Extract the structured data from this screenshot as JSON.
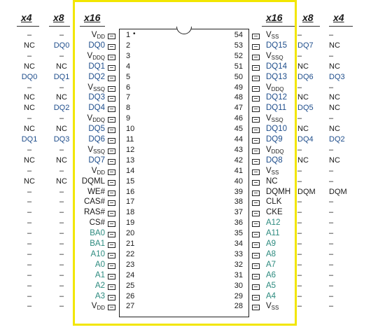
{
  "headers": {
    "left_x4": "x4",
    "left_x8": "x8",
    "left_x16": "x16",
    "right_x16": "x16",
    "right_x8": "x8",
    "right_x4": "x4"
  },
  "pins_left": [
    {
      "num": "1",
      "sig": "V",
      "sub": "DD",
      "x8": "–",
      "x4": "–",
      "c": "dark"
    },
    {
      "num": "2",
      "sig": "DQ0",
      "sub": "",
      "x8": "DQ0",
      "x4": "NC",
      "c": "blue"
    },
    {
      "num": "3",
      "sig": "V",
      "sub": "DDQ",
      "x8": "–",
      "x4": "–",
      "c": "dark"
    },
    {
      "num": "4",
      "sig": "DQ1",
      "sub": "",
      "x8": "NC",
      "x4": "NC",
      "c": "blue"
    },
    {
      "num": "5",
      "sig": "DQ2",
      "sub": "",
      "x8": "DQ1",
      "x4": "DQ0",
      "c": "blue"
    },
    {
      "num": "6",
      "sig": "V",
      "sub": "SSQ",
      "x8": "–",
      "x4": "–",
      "c": "dark"
    },
    {
      "num": "7",
      "sig": "DQ3",
      "sub": "",
      "x8": "NC",
      "x4": "NC",
      "c": "blue"
    },
    {
      "num": "8",
      "sig": "DQ4",
      "sub": "",
      "x8": "DQ2",
      "x4": "NC",
      "c": "blue"
    },
    {
      "num": "9",
      "sig": "V",
      "sub": "DDQ",
      "x8": "–",
      "x4": "–",
      "c": "dark"
    },
    {
      "num": "10",
      "sig": "DQ5",
      "sub": "",
      "x8": "NC",
      "x4": "NC",
      "c": "blue"
    },
    {
      "num": "11",
      "sig": "DQ6",
      "sub": "",
      "x8": "DQ3",
      "x4": "DQ1",
      "c": "blue"
    },
    {
      "num": "12",
      "sig": "V",
      "sub": "SSQ",
      "x8": "–",
      "x4": "–",
      "c": "dark"
    },
    {
      "num": "13",
      "sig": "DQ7",
      "sub": "",
      "x8": "NC",
      "x4": "NC",
      "c": "blue"
    },
    {
      "num": "14",
      "sig": "V",
      "sub": "DD",
      "x8": "–",
      "x4": "–",
      "c": "dark"
    },
    {
      "num": "15",
      "sig": "DQML",
      "sub": "",
      "x8": "NC",
      "x4": "NC",
      "c": "dark"
    },
    {
      "num": "16",
      "sig": "WE#",
      "sub": "",
      "x8": "–",
      "x4": "–",
      "c": "dark"
    },
    {
      "num": "17",
      "sig": "CAS#",
      "sub": "",
      "x8": "–",
      "x4": "–",
      "c": "dark"
    },
    {
      "num": "18",
      "sig": "RAS#",
      "sub": "",
      "x8": "–",
      "x4": "–",
      "c": "dark"
    },
    {
      "num": "19",
      "sig": "CS#",
      "sub": "",
      "x8": "–",
      "x4": "–",
      "c": "dark"
    },
    {
      "num": "20",
      "sig": "BA0",
      "sub": "",
      "x8": "–",
      "x4": "–",
      "c": "teal"
    },
    {
      "num": "21",
      "sig": "BA1",
      "sub": "",
      "x8": "–",
      "x4": "–",
      "c": "teal"
    },
    {
      "num": "22",
      "sig": "A10",
      "sub": "",
      "x8": "–",
      "x4": "–",
      "c": "teal"
    },
    {
      "num": "23",
      "sig": "A0",
      "sub": "",
      "x8": "–",
      "x4": "–",
      "c": "teal"
    },
    {
      "num": "24",
      "sig": "A1",
      "sub": "",
      "x8": "–",
      "x4": "–",
      "c": "teal"
    },
    {
      "num": "25",
      "sig": "A2",
      "sub": "",
      "x8": "–",
      "x4": "–",
      "c": "teal"
    },
    {
      "num": "26",
      "sig": "A3",
      "sub": "",
      "x8": "–",
      "x4": "–",
      "c": "teal"
    },
    {
      "num": "27",
      "sig": "V",
      "sub": "DD",
      "x8": "–",
      "x4": "–",
      "c": "dark"
    }
  ],
  "pins_right": [
    {
      "num": "54",
      "sig": "V",
      "sub": "SS",
      "x8": "–",
      "x4": "–",
      "c": "dark"
    },
    {
      "num": "53",
      "sig": "DQ15",
      "sub": "",
      "x8": "DQ7",
      "x4": "NC",
      "c": "blue"
    },
    {
      "num": "52",
      "sig": "V",
      "sub": "SSQ",
      "x8": "–",
      "x4": "–",
      "c": "dark"
    },
    {
      "num": "51",
      "sig": "DQ14",
      "sub": "",
      "x8": "NC",
      "x4": "NC",
      "c": "blue"
    },
    {
      "num": "50",
      "sig": "DQ13",
      "sub": "",
      "x8": "DQ6",
      "x4": "DQ3",
      "c": "blue"
    },
    {
      "num": "49",
      "sig": "V",
      "sub": "DDQ",
      "x8": "–",
      "x4": "–",
      "c": "dark"
    },
    {
      "num": "48",
      "sig": "DQ12",
      "sub": "",
      "x8": "NC",
      "x4": "NC",
      "c": "blue"
    },
    {
      "num": "47",
      "sig": "DQ11",
      "sub": "",
      "x8": "DQ5",
      "x4": "NC",
      "c": "blue"
    },
    {
      "num": "46",
      "sig": "V",
      "sub": "SSQ",
      "x8": "–",
      "x4": "–",
      "c": "dark"
    },
    {
      "num": "45",
      "sig": "DQ10",
      "sub": "",
      "x8": "NC",
      "x4": "NC",
      "c": "blue"
    },
    {
      "num": "44",
      "sig": "DQ9",
      "sub": "",
      "x8": "DQ4",
      "x4": "DQ2",
      "c": "blue"
    },
    {
      "num": "43",
      "sig": "V",
      "sub": "DDQ",
      "x8": "–",
      "x4": "–",
      "c": "dark"
    },
    {
      "num": "42",
      "sig": "DQ8",
      "sub": "",
      "x8": "NC",
      "x4": "NC",
      "c": "blue"
    },
    {
      "num": "41",
      "sig": "V",
      "sub": "SS",
      "x8": "–",
      "x4": "–",
      "c": "dark"
    },
    {
      "num": "40",
      "sig": "NC",
      "sub": "",
      "x8": "–",
      "x4": "–",
      "c": "dark"
    },
    {
      "num": "39",
      "sig": "DQMH",
      "sub": "",
      "x8": "DQM",
      "x4": "DQM",
      "c": "dark"
    },
    {
      "num": "38",
      "sig": "CLK",
      "sub": "",
      "x8": "–",
      "x4": "–",
      "c": "dark"
    },
    {
      "num": "37",
      "sig": "CKE",
      "sub": "",
      "x8": "–",
      "x4": "–",
      "c": "dark"
    },
    {
      "num": "36",
      "sig": "A12",
      "sub": "",
      "x8": "–",
      "x4": "–",
      "c": "teal"
    },
    {
      "num": "35",
      "sig": "A11",
      "sub": "",
      "x8": "–",
      "x4": "–",
      "c": "teal"
    },
    {
      "num": "34",
      "sig": "A9",
      "sub": "",
      "x8": "–",
      "x4": "–",
      "c": "teal"
    },
    {
      "num": "33",
      "sig": "A8",
      "sub": "",
      "x8": "–",
      "x4": "–",
      "c": "teal"
    },
    {
      "num": "32",
      "sig": "A7",
      "sub": "",
      "x8": "–",
      "x4": "–",
      "c": "teal"
    },
    {
      "num": "31",
      "sig": "A6",
      "sub": "",
      "x8": "–",
      "x4": "–",
      "c": "teal"
    },
    {
      "num": "30",
      "sig": "A5",
      "sub": "",
      "x8": "–",
      "x4": "–",
      "c": "teal"
    },
    {
      "num": "29",
      "sig": "A4",
      "sub": "",
      "x8": "–",
      "x4": "–",
      "c": "teal"
    },
    {
      "num": "28",
      "sig": "V",
      "sub": "SS",
      "x8": "–",
      "x4": "–",
      "c": "dark"
    }
  ],
  "colors": {
    "frame": "#f2e600",
    "dq_blue": "#1f4e8c",
    "addr_teal": "#2b8a7e"
  },
  "pin1_marker": "•"
}
